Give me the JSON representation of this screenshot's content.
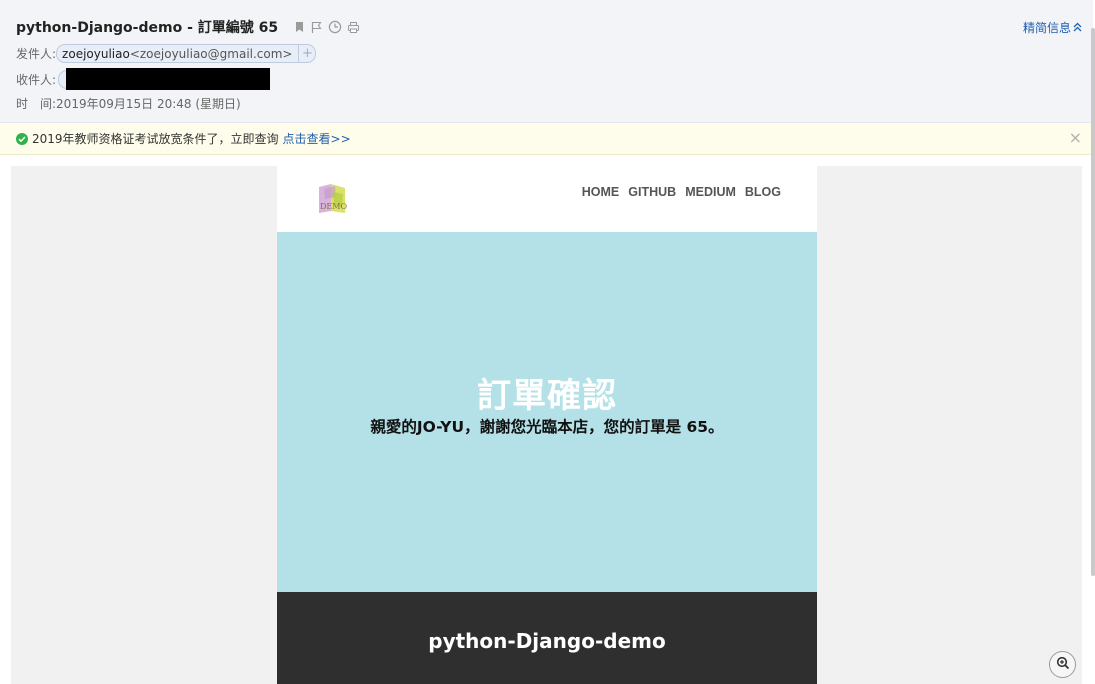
{
  "header": {
    "subject": "python-Django-demo - 訂單編號 65",
    "summary_link": "精简信息",
    "sender_label": "发件人:",
    "sender_name": "zoejoyuliao",
    "sender_address": "<zoejoyuliao@gmail.com>",
    "add_contact": "+",
    "recipient_label": "收件人:",
    "time_label": "时　间:",
    "time_value": "2019年09月15日 20:48 (星期日)"
  },
  "notice": {
    "text": "2019年教师资格证考试放宽条件了，立即查询",
    "link": "点击查看>>",
    "close": "×"
  },
  "email": {
    "logo_text": "DEMO",
    "nav": [
      "HOME",
      "GITHUB",
      "MEDIUM",
      "BLOG"
    ],
    "hero_title": "訂單確認",
    "hero_text": "親愛的JO-YU，謝謝您光臨本店，您的訂單是 65。",
    "footer_title": "python-Django-demo"
  },
  "colors": {
    "link": "#1f5fae",
    "hero_bg": "#b3e1e7",
    "footer_bg": "#2f2f2f",
    "notice_bg": "#fefdeb",
    "success_green": "#2fb24a"
  }
}
